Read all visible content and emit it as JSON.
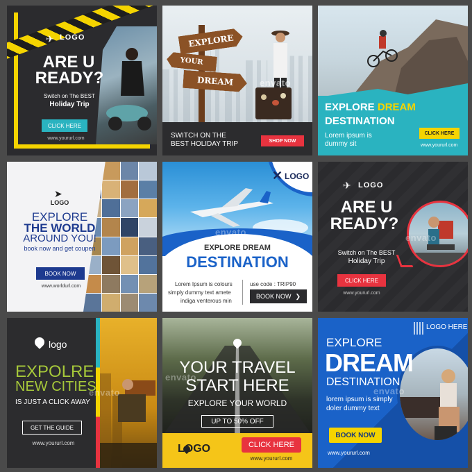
{
  "tiles": {
    "t1": {
      "logo": "LOGO",
      "headline1": "ARE U",
      "headline2": "READY?",
      "sub1": "Switch on The BEST",
      "sub2": "Holiday Trip",
      "button": "CLICK HERE",
      "url": "www.yoururl.com"
    },
    "t2": {
      "sign1": "EXPLORE",
      "sign2": "YOUR",
      "sign3": "DREAM",
      "bottom1": "SWITCH ON THE",
      "bottom2": "BEST HOLIDAY TRIP",
      "button": "SHOP NOW",
      "watermark": "envato"
    },
    "t3": {
      "line1a": "EXPLORE ",
      "line1b": "DREAM",
      "line2": "DESTINATION",
      "body1": "Lorem ipsum is",
      "body2": "dummy sit",
      "button": "CLICK HERE",
      "url": "www.yoururl.com"
    },
    "t4": {
      "logo": "LOGO",
      "line1": "EXPLORE",
      "line2": "THE WORLD",
      "line3": "AROUND YOU!",
      "line4": "book now and get coupen",
      "button": "BOOK NOW",
      "url": "www.worldurl.com"
    },
    "t5": {
      "logo": "LOGO",
      "line1": "EXPLORE DREAM",
      "line2": "DESTINATION",
      "body1": "Lorem Ipsum is colours",
      "body2": "simply dummy text amete",
      "body3": "indiga venterous min",
      "code": "use code : TRIP90",
      "button": "BOOK NOW",
      "watermark": "envato"
    },
    "t6": {
      "logo": "LOGO",
      "headline1": "ARE U",
      "headline2": "READY?",
      "sub1": "Switch on The BEST",
      "sub2": "Holiday Trip",
      "button": "CLICK HERE",
      "url": "www.yoururl.com",
      "watermark": "envato"
    },
    "t7": {
      "logo": "logo",
      "line1": "EXPOLRE",
      "line2": "NEW CITIES",
      "line3": "IS JUST A CLICK AWAY",
      "button": "GET THE GUIDE",
      "url": "www.yoururl.com",
      "watermark": "envato"
    },
    "t8": {
      "line1": "YOUR TRAVEL",
      "line2": "START HERE",
      "line3": "EXPLORE YOUR WORLD",
      "line4": "UP TO 50% OFF",
      "logo": "LOGO",
      "button": "CLICK HERE",
      "url": "www.yoururl.com",
      "watermark": "envato"
    },
    "t9": {
      "logo": "LOGO HERE",
      "line1": "EXPLORE",
      "line2": "DREAM",
      "line3": "DESTINATION",
      "body1": "lorem ipsum is simply",
      "body2": "doler dummy text",
      "button": "BOOK NOW",
      "url": "www.yoururl.com",
      "watermark": "envato"
    }
  },
  "colors": {
    "yellow": "#f5d400",
    "teal": "#2ab3c0",
    "red": "#e8333f",
    "navy": "#1d3a8f",
    "blue": "#1a62c8"
  }
}
